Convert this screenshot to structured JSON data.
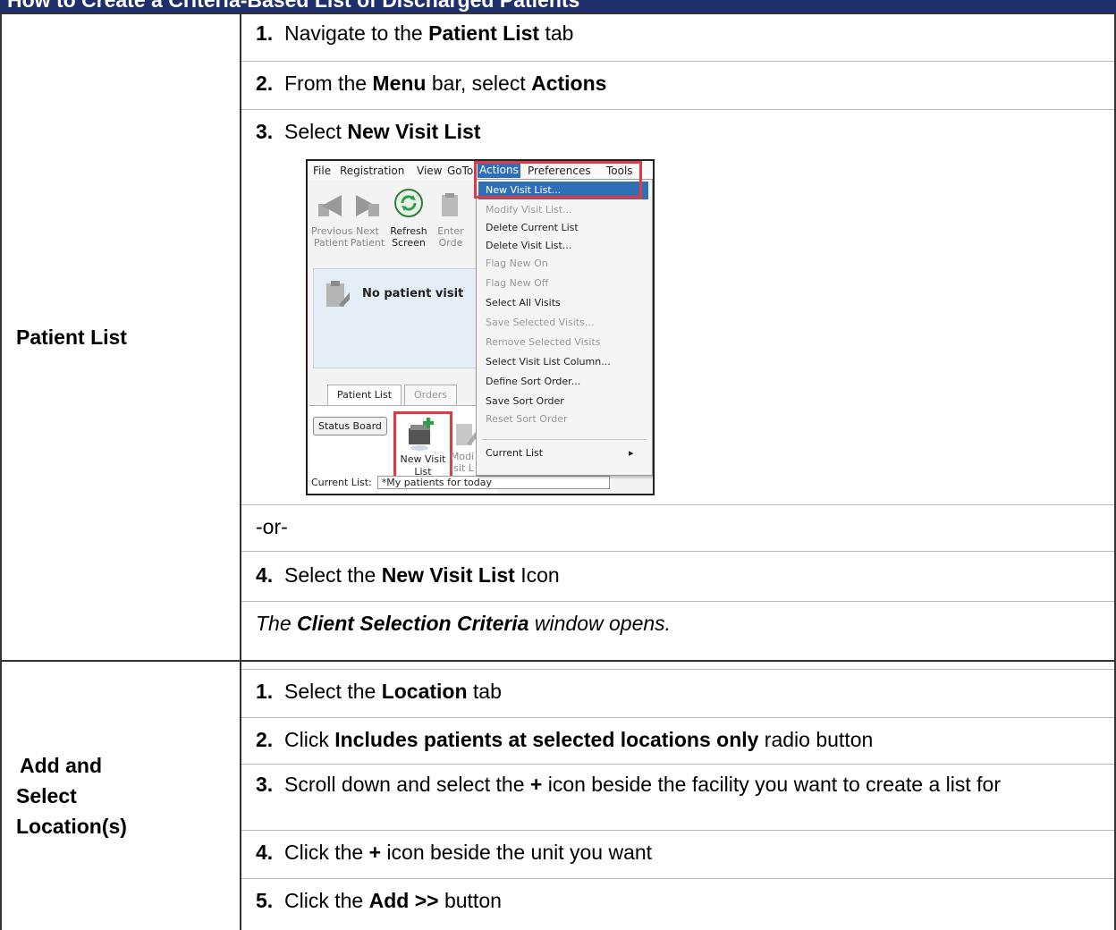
{
  "header": {
    "title": "How to Create a Criteria-Based List of Discharged Patients"
  },
  "sections": [
    {
      "label": "Patient List",
      "steps": [
        {
          "num": "1.",
          "pre": "Navigate to the ",
          "bold": "Patient List",
          "post": " tab"
        },
        {
          "num": "2.",
          "pre": "From the ",
          "bold": "Menu",
          "mid": " bar, select ",
          "bold2": "Actions"
        },
        {
          "num": "3.",
          "pre": "Select ",
          "bold": "New Visit List"
        }
      ],
      "or": "-or-",
      "step4": {
        "num": "4.",
        "pre": "Select the ",
        "bold": "New Visit List",
        "post": " Icon"
      },
      "note": {
        "bold": "Client Selection Criteria",
        "post": " window opens.",
        "pre": "The "
      }
    },
    {
      "label_line1": "Add and",
      "label_line2": "Select",
      "label_line3": "Location(s)",
      "steps": [
        {
          "num": "1.",
          "pre": "Select the ",
          "bold": "Location",
          "post": " tab"
        },
        {
          "num": "2.",
          "pre": "Click ",
          "bold": "Includes patients at selected locations only",
          "post": " radio button"
        },
        {
          "num": "3.",
          "pre": "Scroll down and select the ",
          "bold": "+",
          "post": " icon beside the facility you want to create a list for"
        },
        {
          "num": "4.",
          "pre": "Click the ",
          "bold": "+",
          "post": " icon beside the unit you want"
        },
        {
          "num": "5.",
          "pre": "Click the ",
          "bold": "Add >>",
          "post": " button"
        }
      ]
    }
  ],
  "screenshot": {
    "menubar": [
      "File",
      "Registration",
      "View",
      "GoTo",
      "Actions",
      "Preferences",
      "Tools"
    ],
    "toolbar": [
      {
        "line1": "Previous",
        "line2": "Patient"
      },
      {
        "line1": "Next",
        "line2": "Patient"
      },
      {
        "line1": "Refresh",
        "line2": "Screen"
      },
      {
        "line1": "Enter",
        "line2": "Orde"
      }
    ],
    "banner_text": "No patient visit",
    "tabs": [
      "Patient List",
      "Orders"
    ],
    "status_board": "Status Board",
    "new_visit_list_line1": "New Visit",
    "new_visit_list_line2": "List",
    "modify_partial_line1": "Modi",
    "modify_partial_line2": "isit L",
    "current_list_label": "Current List:",
    "current_list_value": "*My patients for today",
    "menu_items": [
      {
        "label": "New Visit List...",
        "state": "highlighted"
      },
      {
        "label": "Modify Visit List...",
        "state": "disabled"
      },
      {
        "label": "Delete Current List",
        "state": "enabled"
      },
      {
        "label": "Delete Visit List...",
        "state": "enabled"
      },
      {
        "label": "Flag New On",
        "state": "disabled"
      },
      {
        "label": "Flag New Off",
        "state": "disabled"
      },
      {
        "label": "Select All Visits",
        "state": "enabled"
      },
      {
        "label": "Save Selected Visits...",
        "state": "disabled"
      },
      {
        "label": "Remove Selected Visits",
        "state": "disabled"
      },
      {
        "label": "Select Visit List Column...",
        "state": "enabled"
      },
      {
        "label": "Define Sort Order...",
        "state": "enabled"
      },
      {
        "label": "Save Sort Order",
        "state": "enabled"
      },
      {
        "label": "Reset Sort Order",
        "state": "disabled"
      },
      {
        "label": "Current List",
        "state": "submenu"
      }
    ],
    "submenu_arrow": "▸",
    "colors": {
      "highlight": "#2f6fb5",
      "callout": "#e03a44",
      "header": "#1f2f6b"
    }
  }
}
